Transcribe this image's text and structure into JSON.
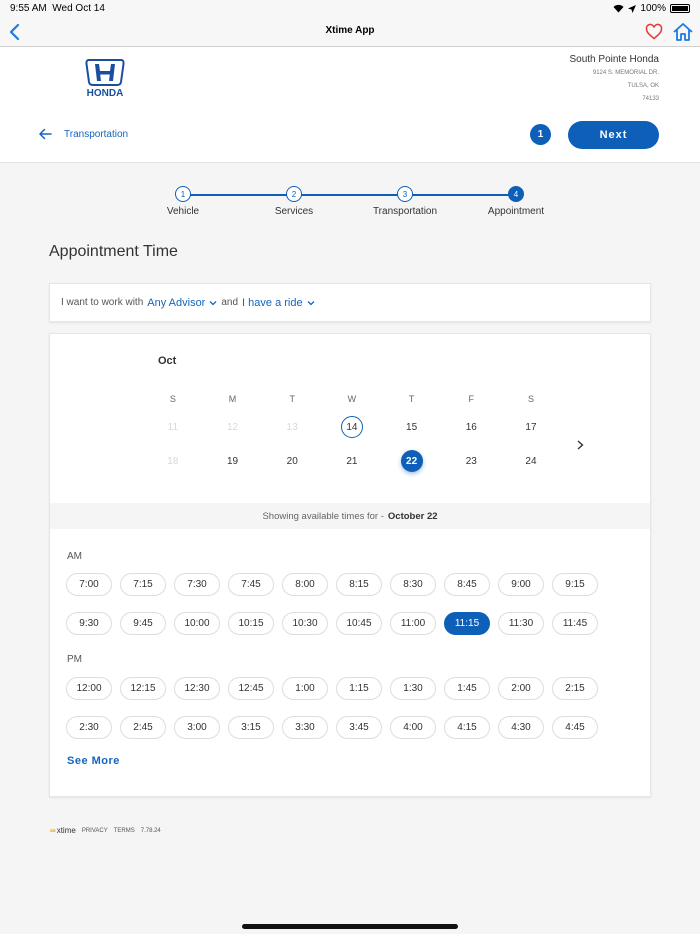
{
  "statusbar": {
    "time": "9:55 AM",
    "date": "Wed Oct 14",
    "battery": "100%"
  },
  "navbar": {
    "title": "Xtime App"
  },
  "dealer": {
    "logo_text": "HONDA",
    "name": "South Pointe Honda",
    "address_line1": "9124 S. MEMORIAL DR.",
    "address_line2": "TULSA, OK",
    "address_line3": "74133"
  },
  "header": {
    "back_label": "Transportation",
    "step_count": "1",
    "next_label": "Next"
  },
  "stepper": [
    {
      "num": "1",
      "label": "Vehicle"
    },
    {
      "num": "2",
      "label": "Services"
    },
    {
      "num": "3",
      "label": "Transportation"
    },
    {
      "num": "4",
      "label": "Appointment"
    }
  ],
  "section_title": "Appointment Time",
  "prefs": {
    "prefix": "I want to work with",
    "advisor": "Any Advisor",
    "joiner": "and",
    "ride": "I have a ride"
  },
  "calendar": {
    "month": "Oct",
    "dow": [
      "S",
      "M",
      "T",
      "W",
      "T",
      "F",
      "S"
    ],
    "week1": [
      "11",
      "12",
      "13",
      "14",
      "15",
      "16",
      "17"
    ],
    "week2": [
      "18",
      "19",
      "20",
      "21",
      "22",
      "23",
      "24"
    ]
  },
  "showing": {
    "prefix": "Showing available times for -",
    "date": "October 22"
  },
  "am": {
    "label": "AM",
    "slots": [
      "7:00",
      "7:15",
      "7:30",
      "7:45",
      "8:00",
      "8:15",
      "8:30",
      "8:45",
      "9:00",
      "9:15",
      "9:30",
      "9:45",
      "10:00",
      "10:15",
      "10:30",
      "10:45",
      "11:00",
      "11:15",
      "11:30",
      "11:45"
    ]
  },
  "pm": {
    "label": "PM",
    "slots": [
      "12:00",
      "12:15",
      "12:30",
      "12:45",
      "1:00",
      "1:15",
      "1:30",
      "1:45",
      "2:00",
      "2:15",
      "2:30",
      "2:45",
      "3:00",
      "3:15",
      "3:30",
      "3:45",
      "4:00",
      "4:15",
      "4:30",
      "4:45"
    ]
  },
  "see_more": "See More",
  "footer": {
    "brand": "xtime",
    "privacy": "PRIVACY",
    "terms": "TERMS",
    "version": "7.78.24"
  },
  "colors": {
    "accent": "#0d5fb8",
    "link": "#1565c0",
    "heart": "#e53935"
  }
}
